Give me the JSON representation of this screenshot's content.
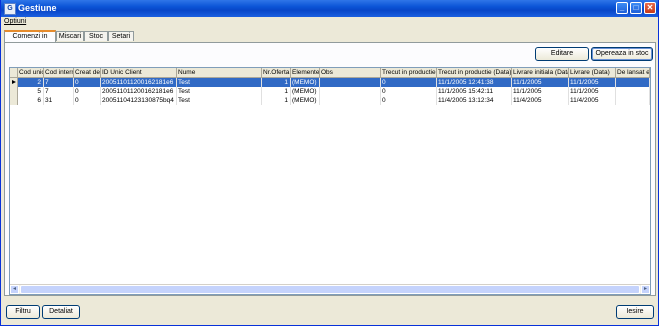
{
  "window": {
    "title": "Gestiune",
    "app_icon": "G"
  },
  "menu": {
    "optiuni": "Optiuni"
  },
  "tabs": [
    {
      "label": "Comenzi in lucru",
      "active": true
    },
    {
      "label": "Miscari"
    },
    {
      "label": "Stoc"
    },
    {
      "label": "Setari"
    }
  ],
  "toolbar": {
    "editare": "Editare",
    "opereaza": "Opereaza in stoc"
  },
  "grid": {
    "columns": [
      "Cod unic",
      "Cod intern",
      "Creat de",
      "ID Unic Client",
      "Nume",
      "Nr.Oferta",
      "Elemente",
      "Obs",
      "Trecut in productie",
      "Trecut in productie (Data)",
      "Livrare initiala (Data)",
      "Livrare (Data)",
      "De lansat e"
    ],
    "rows": [
      [
        "2",
        "7",
        "0",
        "200511011200162181e6",
        "Test",
        "1",
        "(MEMO)",
        "",
        "0",
        "11/1/2005 12:41:38",
        "11/1/2005",
        "11/1/2005",
        ""
      ],
      [
        "5",
        "7",
        "0",
        "200511011200162181e6",
        "Test",
        "1",
        "(MEMO)",
        "",
        "0",
        "11/1/2005 15:42:11",
        "11/1/2005",
        "11/1/2005",
        ""
      ],
      [
        "6",
        "31",
        "0",
        "20051104123130875bq4",
        "Test",
        "1",
        "(MEMO)",
        "",
        "0",
        "11/4/2005 13:12:34",
        "11/4/2005",
        "11/4/2005",
        ""
      ]
    ],
    "selected_row": 0
  },
  "footer": {
    "filtru": "Filtru",
    "detaliat": "Detaliat",
    "iesire": "Iesire"
  },
  "icons": {
    "scroll_left": "◂",
    "scroll_right": "▸",
    "minimize": "_",
    "maximize": "□",
    "close": "✕"
  }
}
